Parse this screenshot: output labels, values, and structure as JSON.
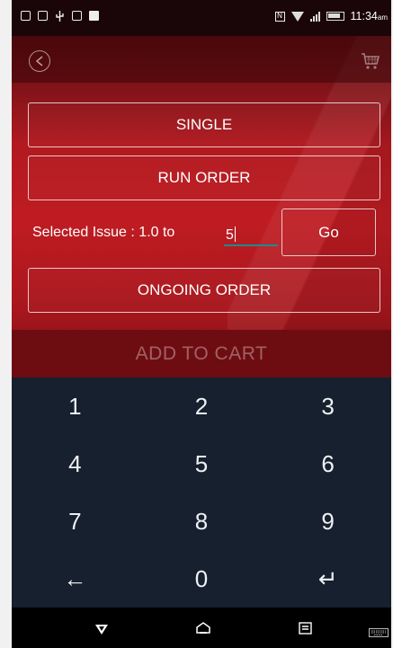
{
  "status_bar": {
    "left_icons": [
      "window-icon",
      "image-icon",
      "usb-icon",
      "media-icon",
      "briefcase-icon"
    ],
    "right_icons": [
      "nfc-icon",
      "wifi-icon",
      "signal-icon",
      "battery-icon"
    ],
    "time": "11:34",
    "time_suffix": "am"
  },
  "toolbar": {
    "back_icon": "back-circle-icon",
    "cart_icon": "cart-icon"
  },
  "options": {
    "single_label": "SINGLE",
    "run_order_label": "RUN ORDER",
    "ongoing_label": "ONGOING ORDER"
  },
  "issue": {
    "label": "Selected Issue : 1.0 to",
    "value": "5",
    "go_label": "Go"
  },
  "add_to_cart_label": "ADD TO CART",
  "keypad": {
    "keys": [
      "1",
      "2",
      "3",
      "4",
      "5",
      "6",
      "7",
      "8",
      "9",
      "←",
      "0",
      "↵"
    ]
  },
  "colors": {
    "accent_red": "#be1c22",
    "dark_red": "#6e0d11",
    "keypad_bg": "#16202e",
    "input_underline": "#1b8c8c"
  }
}
